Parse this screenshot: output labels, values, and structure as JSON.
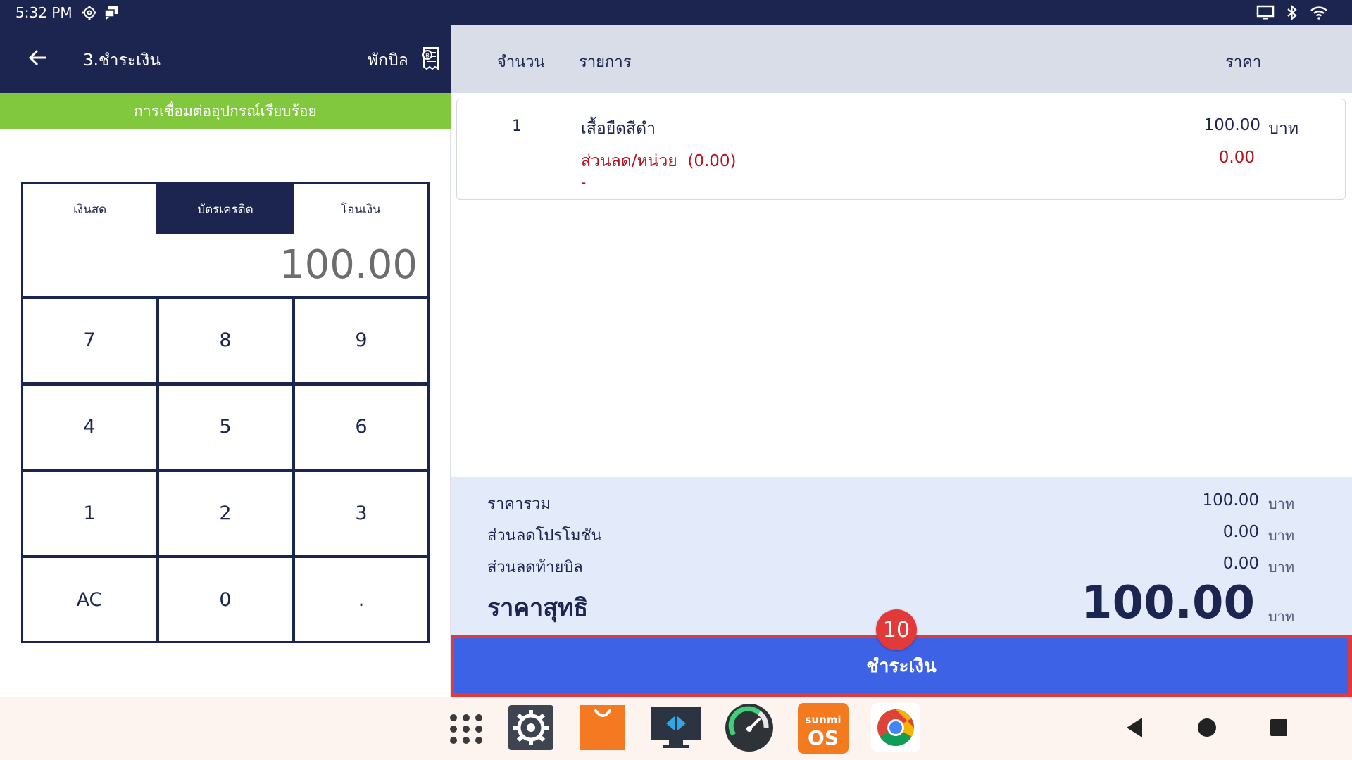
{
  "status_bar": {
    "time": "5:32 PM",
    "icons": [
      "settings-gear-icon",
      "chat-bubble-icon",
      "cast-screen-icon",
      "bluetooth-icon",
      "wifi-icon"
    ]
  },
  "header": {
    "title": "3.ชำระเงิน",
    "hold_bill_label": "พักบิล",
    "back_icon": "arrow-left-icon",
    "receipt_icon": "receipt-icon"
  },
  "connection_banner": "การเชื่อมต่ออุปกรณ์เรียบร้อย",
  "payment": {
    "tabs": [
      {
        "label": "เงินสด",
        "active": false
      },
      {
        "label": "บัตรเครดิต",
        "active": true
      },
      {
        "label": "โอนเงิน",
        "active": false
      }
    ],
    "amount": "100.00",
    "keypad": [
      "7",
      "8",
      "9",
      "4",
      "5",
      "6",
      "1",
      "2",
      "3",
      "AC",
      "0",
      "."
    ]
  },
  "table": {
    "headers": {
      "qty": "จำนวน",
      "item": "รายการ",
      "price": "ราคา"
    },
    "items": [
      {
        "qty": "1",
        "name": "เสื้อยืดสีดำ",
        "price": "100.00",
        "currency": "บาท",
        "discount_label": "ส่วนลด/หน่วย",
        "discount_paren": "(0.00)",
        "discount_value": "0.00",
        "note": "-"
      }
    ]
  },
  "summary": {
    "subtotal_label": "ราคารวม",
    "subtotal_value": "100.00",
    "promo_label": "ส่วนลดโปรโมชัน",
    "promo_value": "0.00",
    "bill_discount_label": "ส่วนลดท้ายบิล",
    "bill_discount_value": "0.00",
    "net_label": "ราคาสุทธิ",
    "net_value": "100.00",
    "unit": "บาท"
  },
  "pay_button_label": "ชำระเงิน",
  "step_badge": "10",
  "taskbar": {
    "apps": [
      "app-drawer-icon",
      "settings-app-icon",
      "shopping-bag-app-icon",
      "remote-display-app-icon",
      "speedometer-app-icon",
      "sunmi-os-app-icon",
      "chrome-app-icon"
    ],
    "sunmi_text_top": "sunmi",
    "sunmi_text_bottom": "OS",
    "nav": [
      "nav-back-icon",
      "nav-home-icon",
      "nav-recents-icon"
    ]
  },
  "colors": {
    "navy": "#1c2550",
    "green": "#82c83f",
    "accent_blue": "#3d62e6",
    "highlight_red": "#e23a3a",
    "discount_red": "#b0141c",
    "summary_bg": "#e3ebfb"
  }
}
